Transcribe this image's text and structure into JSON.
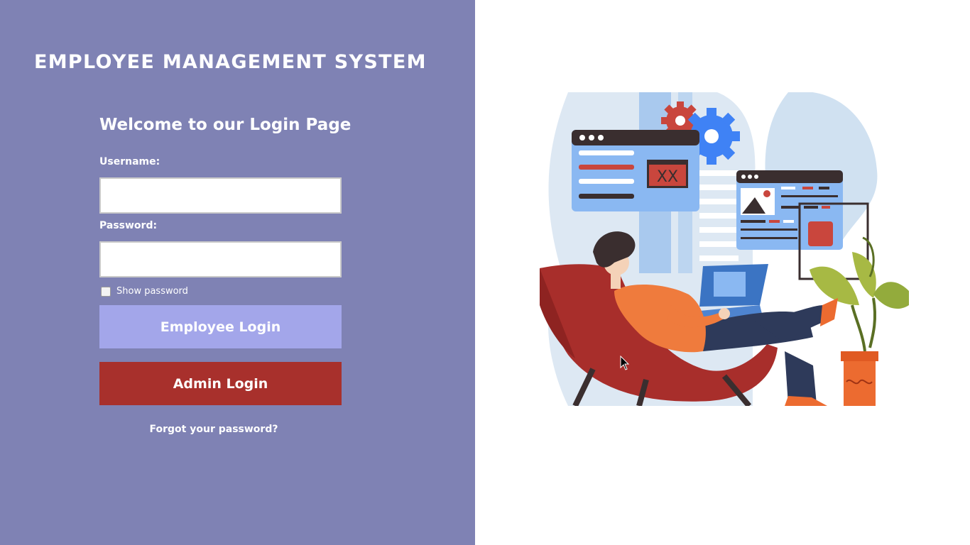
{
  "app": {
    "title": "EMPLOYEE MANAGEMENT SYSTEM"
  },
  "login": {
    "welcome": "Welcome to our Login Page",
    "username_label": "Username:",
    "username_value": "",
    "password_label": "Password:",
    "password_value": "",
    "show_password_label": "Show password",
    "show_password_checked": false,
    "employee_login_label": "Employee Login",
    "admin_login_label": "Admin Login",
    "forgot_password_label": "Forgot your password?"
  },
  "illustration": {
    "subject": "person-on-chair-with-laptop"
  },
  "colors": {
    "panel_bg": "#7f82b4",
    "employee_button": "#a3a6ea",
    "admin_button": "#a8302c",
    "text": "#ffffff"
  }
}
